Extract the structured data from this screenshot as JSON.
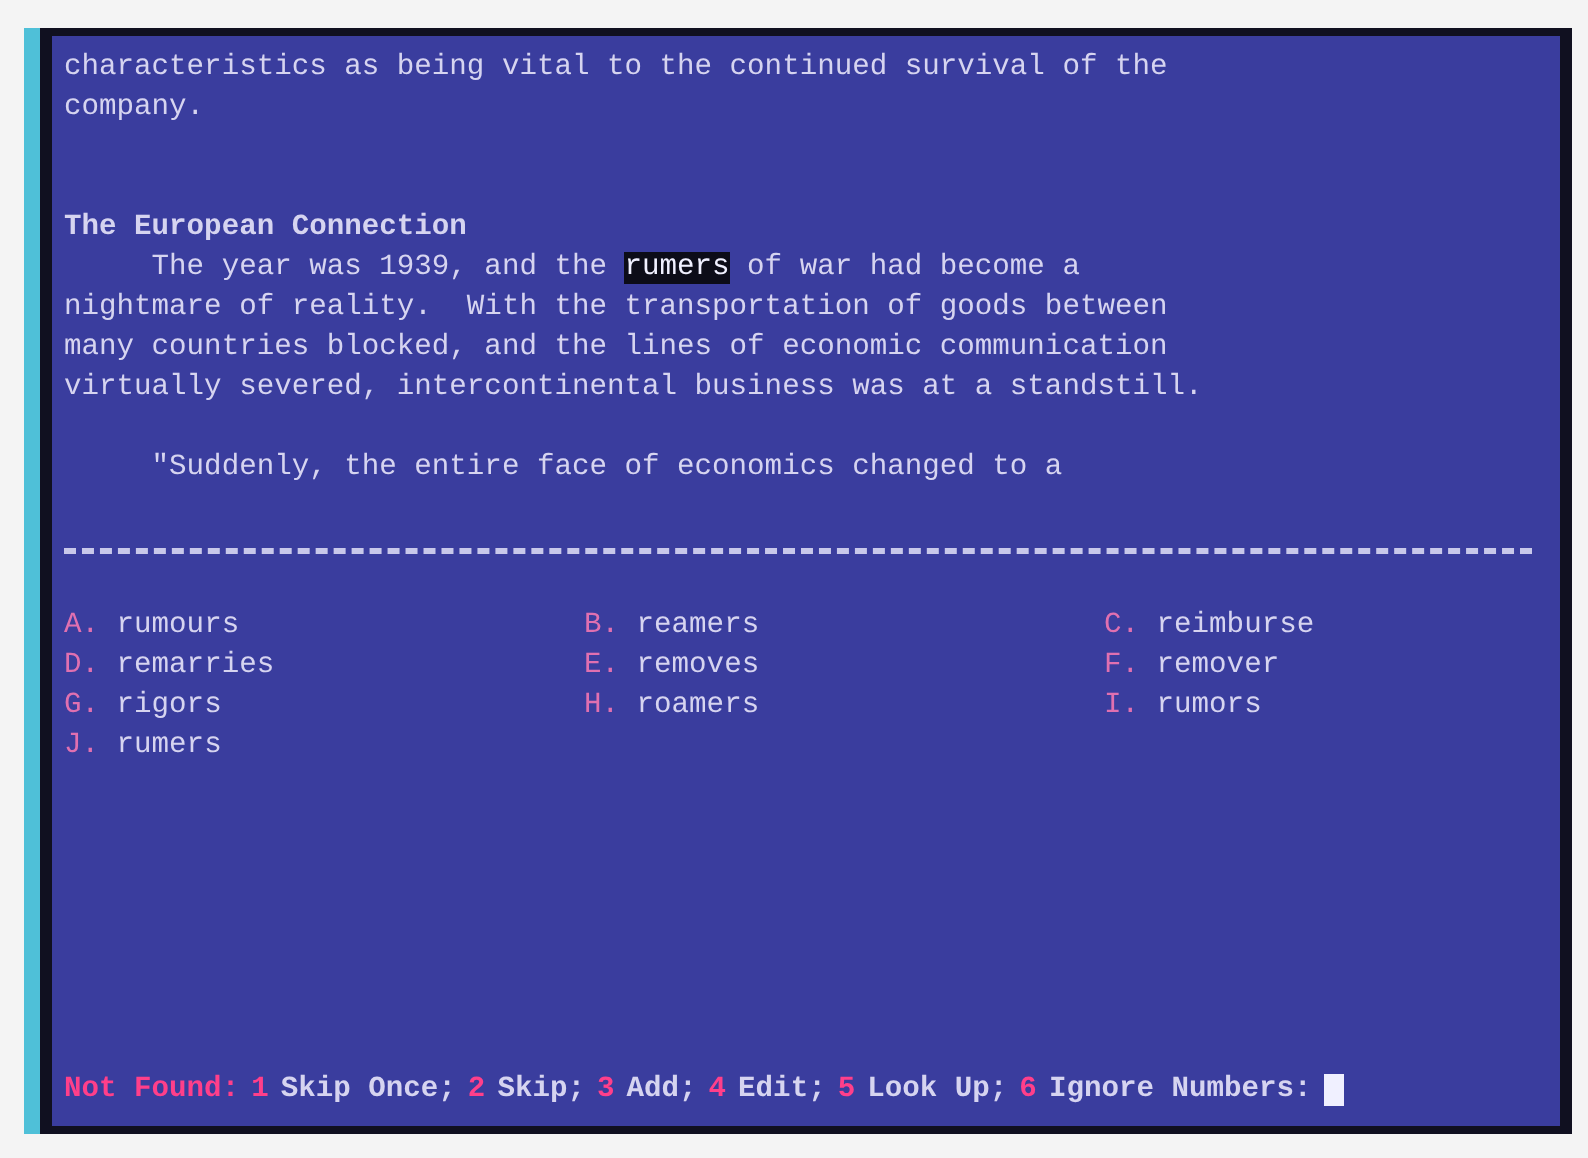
{
  "document": {
    "lines": [
      {
        "kind": "text",
        "text": "characteristics as being vital to the continued survival of the"
      },
      {
        "kind": "text",
        "text": "company."
      },
      {
        "kind": "blank"
      },
      {
        "kind": "blank"
      },
      {
        "kind": "heading",
        "text": "The European Connection"
      },
      {
        "kind": "flagged",
        "before": "     The year was 1939, and the ",
        "word": "rumers",
        "after": " of war had become a"
      },
      {
        "kind": "text",
        "text": "nightmare of reality.  With the transportation of goods between"
      },
      {
        "kind": "text",
        "text": "many countries blocked, and the lines of economic communication"
      },
      {
        "kind": "text",
        "text": "virtually severed, intercontinental business was at a standstill."
      },
      {
        "kind": "blank"
      },
      {
        "kind": "text",
        "text": "     \"Suddenly, the entire face of economics changed to a"
      }
    ]
  },
  "suggestions": [
    {
      "key": "A.",
      "word": "rumours"
    },
    {
      "key": "B.",
      "word": "reamers"
    },
    {
      "key": "C.",
      "word": "reimburse"
    },
    {
      "key": "D.",
      "word": "remarries"
    },
    {
      "key": "E.",
      "word": "removes"
    },
    {
      "key": "F.",
      "word": "remover"
    },
    {
      "key": "G.",
      "word": "rigors"
    },
    {
      "key": "H.",
      "word": "roamers"
    },
    {
      "key": "I.",
      "word": "rumors"
    },
    {
      "key": "J.",
      "word": "rumers"
    }
  ],
  "status_bar": {
    "prompt": "Not Found:",
    "commands": [
      {
        "key": "1",
        "label": "Skip Once;"
      },
      {
        "key": "2",
        "label": "Skip;"
      },
      {
        "key": "3",
        "label": "Add;"
      },
      {
        "key": "4",
        "label": "Edit;"
      },
      {
        "key": "5",
        "label": "Look Up;"
      },
      {
        "key": "6",
        "label": "Ignore Numbers:"
      }
    ]
  }
}
